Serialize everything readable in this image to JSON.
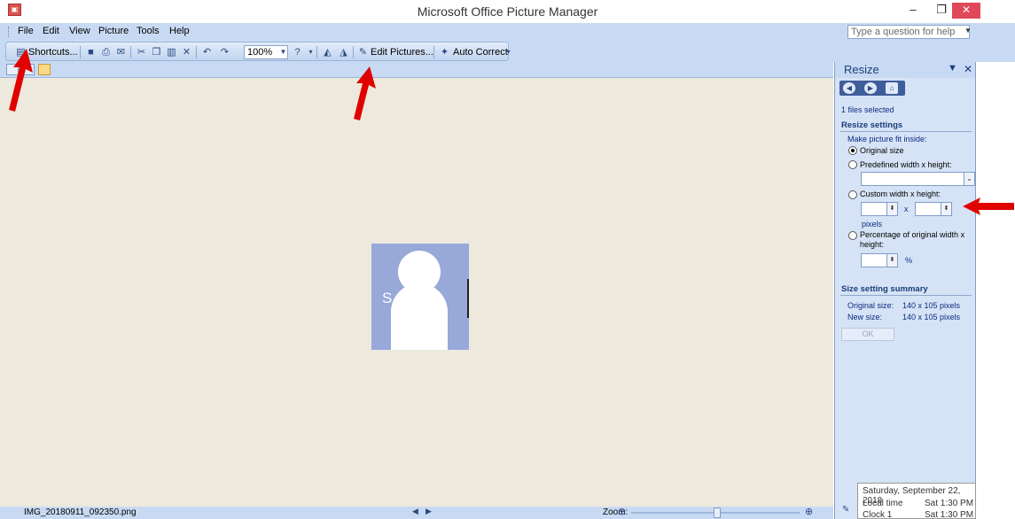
{
  "window": {
    "title": "Microsoft Office Picture Manager",
    "app_icon": "picture-manager-icon",
    "min_glyph": "–",
    "max_glyph": "❐",
    "close_glyph": "✕"
  },
  "menu": {
    "items": [
      "File",
      "Edit",
      "View",
      "Picture",
      "Tools",
      "Help"
    ],
    "help_placeholder": "Type a question for help"
  },
  "toolbar": {
    "shortcuts_label": "Shortcuts...",
    "zoom_value": "100%",
    "edit_pictures_label": "Edit Pictures...",
    "auto_correct_label": "Auto Correct"
  },
  "preview": {
    "initial": "S"
  },
  "status": {
    "filename": "IMG_20180911_092350.png",
    "zoom_label": "Zoom:"
  },
  "task_pane": {
    "title": "Resize",
    "files_selected": "1 files selected",
    "resize_settings_heading": "Resize settings",
    "fit_inside_label": "Make picture fit inside:",
    "options": [
      {
        "label": "Original size",
        "checked": true
      },
      {
        "label": "Predefined width x height:",
        "checked": false
      },
      {
        "label": "Custom width x height:",
        "checked": false
      },
      {
        "label": "Percentage of original width x height:",
        "checked": false
      }
    ],
    "times_sign": "x",
    "pixels_label": "pixels",
    "percent_sign": "%",
    "summary_heading": "Size setting summary",
    "original_size_label": "Original size:",
    "original_size_value": "140 x 105 pixels",
    "new_size_label": "New size:",
    "new_size_value": "140 x 105 pixels",
    "ok_label": "OK"
  },
  "clock": {
    "date": "Saturday, September 22, 2018",
    "local_label": "Local time",
    "local_value": "Sat 1:30 PM",
    "clock1_label": "Clock 1",
    "clock1_value": "Sat 1:30 PM"
  },
  "colors": {
    "chrome": "#c8daf3",
    "canvas": "#ede9dc",
    "pane": "#d6e3f6",
    "annotation_arrow": "#e00000",
    "close_button": "#e0485a"
  }
}
